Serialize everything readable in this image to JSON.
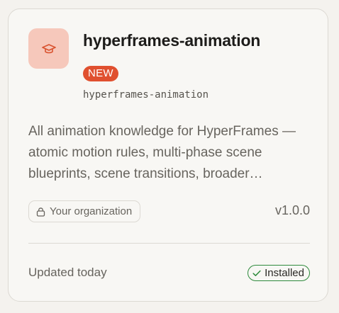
{
  "card": {
    "title": "hyperframes-animation",
    "badge": "NEW",
    "slug": "hyperframes-animation",
    "description": "All animation knowledge for HyperFrames — atomic motion rules, multi-phase scene blueprints, scene transitions, broader…",
    "visibility_label": "Your organization",
    "version": "v1.0.0",
    "updated": "Updated today",
    "status_label": "Installed",
    "icon": "graduation-cap-icon",
    "colors": {
      "icon_tile_bg": "#f6c8bb",
      "icon_stroke": "#d9532f",
      "badge_bg": "#e0502f",
      "installed_border": "#2e8a3c"
    }
  }
}
